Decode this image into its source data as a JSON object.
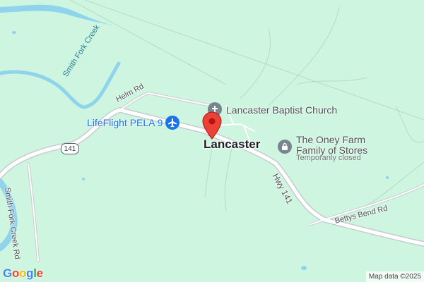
{
  "map": {
    "town_label": "Lancaster",
    "roads": {
      "helm_rd": "Helm Rd",
      "shield_141": "141",
      "hwy_141": "Hwy 141",
      "bettys_bend_rd": "Bettys Bend Rd",
      "smith_fork_creek_rd": "Smith Fork Creek Rd"
    },
    "water": {
      "smith_fork_creek": "Smith Fork Creek"
    },
    "pois": {
      "church": {
        "name": "Lancaster Baptist Church",
        "icon": "church-icon"
      },
      "airport": {
        "name": "LifeFlight PELA 9",
        "icon": "airport-icon"
      },
      "store": {
        "name_line1": "The Oney Farm",
        "name_line2": "Family of Stores",
        "status": "Temporarily closed",
        "icon": "store-icon"
      }
    },
    "pin": {
      "icon": "map-pin-icon",
      "color": "#ea4335"
    },
    "logo_text": "Google",
    "attribution": "Map data ©2025"
  },
  "colors": {
    "land": "#cdf5df",
    "water": "#8fd3ec",
    "road": "#ffffff",
    "road_casing": "#c8ccd0",
    "poi_gray": "#78858f",
    "airport_blue": "#1a73e8"
  }
}
